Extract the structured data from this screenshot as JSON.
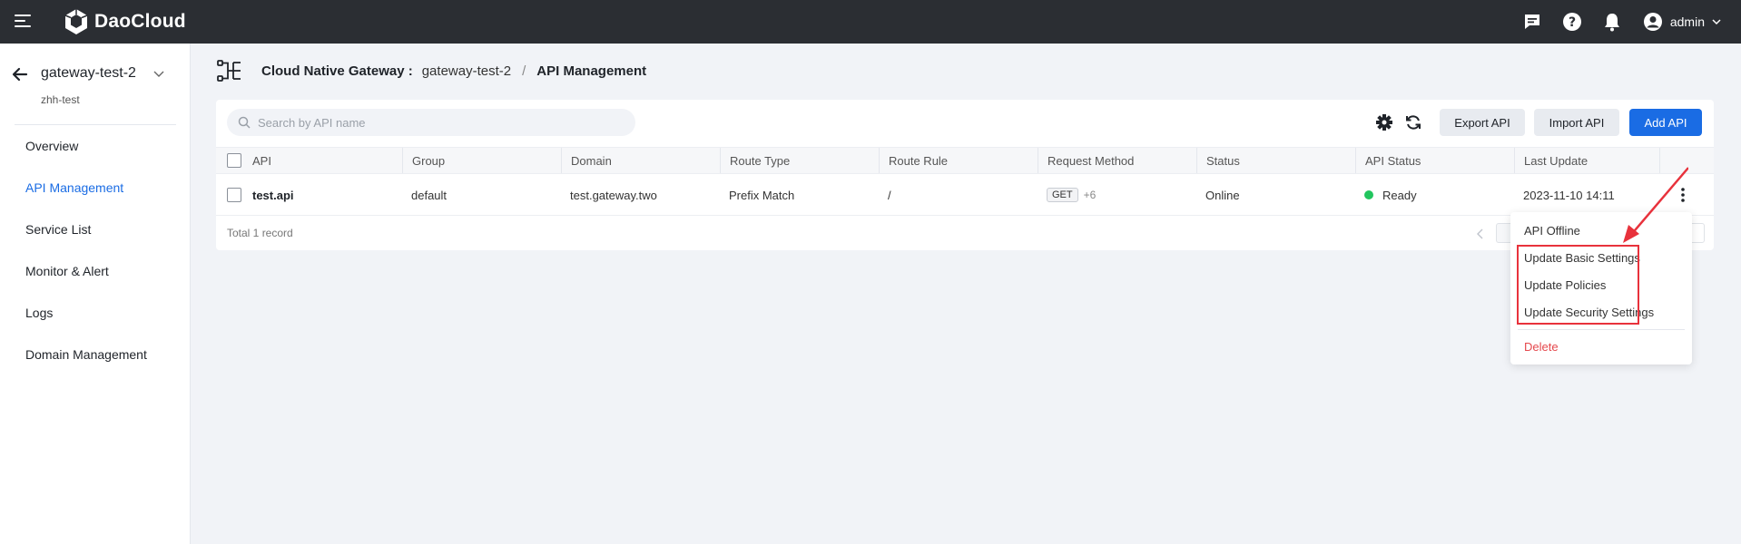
{
  "app": {
    "brand": "DaoCloud",
    "user": "admin"
  },
  "sidebar": {
    "gateway_name": "gateway-test-2",
    "workspace": "zhh-test",
    "items": [
      {
        "label": "Overview",
        "active": false
      },
      {
        "label": "API Management",
        "active": true
      },
      {
        "label": "Service List",
        "active": false
      },
      {
        "label": "Monitor & Alert",
        "active": false
      },
      {
        "label": "Logs",
        "active": false
      },
      {
        "label": "Domain Management",
        "active": false
      }
    ]
  },
  "breadcrumb": {
    "root": "Cloud Native Gateway :",
    "gateway": "gateway-test-2",
    "separator": "/",
    "current": "API Management"
  },
  "toolbar": {
    "search_placeholder": "Search by API name",
    "export_label": "Export API",
    "import_label": "Import API",
    "add_label": "Add API"
  },
  "table": {
    "columns": [
      "API",
      "Group",
      "Domain",
      "Route Type",
      "Route Rule",
      "Request Method",
      "Status",
      "API Status",
      "Last Update"
    ],
    "rows": [
      {
        "api": "test.api",
        "group": "default",
        "domain": "test.gateway.two",
        "route_type": "Prefix Match",
        "route_rule": "/",
        "method": "GET",
        "method_more": "+6",
        "status": "Online",
        "api_status": "Ready",
        "last_update": "2023-11-10 14:11"
      }
    ],
    "total": "Total 1 record"
  },
  "dropdown": {
    "items": [
      "API Offline",
      "Update Basic Settings",
      "Update Policies",
      "Update Security Settings"
    ],
    "delete_label": "Delete"
  },
  "colors": {
    "topbar": "#2b2e33",
    "accent": "#1a6ce4",
    "ready": "#22c55e",
    "danger": "#e5484d",
    "annotation": "#e8323c"
  }
}
